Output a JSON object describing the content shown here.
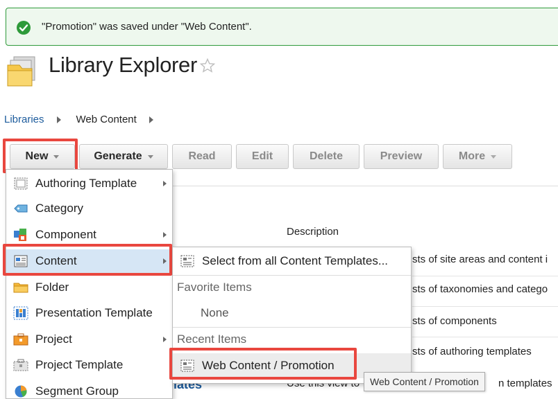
{
  "message": {
    "text": "\"Promotion\" was saved under \"Web Content\"."
  },
  "header": {
    "title": "Library Explorer"
  },
  "breadcrumb": [
    {
      "label": "Libraries"
    },
    {
      "label": "Web Content"
    }
  ],
  "toolbar": {
    "new_label": "New",
    "generate_label": "Generate",
    "read_label": "Read",
    "edit_label": "Edit",
    "delete_label": "Delete",
    "preview_label": "Preview",
    "more_label": "More"
  },
  "table": {
    "description_header": "Description",
    "rows": [
      "sts of site areas and content i",
      "sts of taxonomies and catego",
      "sts of components",
      "sts of authoring templates"
    ],
    "partial_title": "lates",
    "partial_desc": "Use this view to",
    "partial_end": "n templates"
  },
  "new_menu": {
    "items": [
      {
        "label": "Authoring Template",
        "icon": "authoring-template-icon"
      },
      {
        "label": "Category",
        "icon": "category-tag-icon"
      },
      {
        "label": "Component",
        "icon": "component-icon"
      },
      {
        "label": "Content",
        "icon": "content-icon"
      },
      {
        "label": "Folder",
        "icon": "folder-icon"
      },
      {
        "label": "Presentation Template",
        "icon": "presentation-template-icon"
      },
      {
        "label": "Project",
        "icon": "project-icon"
      },
      {
        "label": "Project Template",
        "icon": "project-template-icon"
      },
      {
        "label": "Segment Group",
        "icon": "segment-group-icon"
      }
    ]
  },
  "content_submenu": {
    "select_all": "Select from all Content Templates...",
    "favorites_header": "Favorite Items",
    "favorites_none": "None",
    "recent_header": "Recent Items",
    "recent_item": "Web Content / Promotion"
  },
  "tooltip": {
    "text": "Web Content / Promotion"
  },
  "colors": {
    "highlight": "#e9473f",
    "success": "#2e9a3a",
    "link": "#1c5b9c"
  }
}
